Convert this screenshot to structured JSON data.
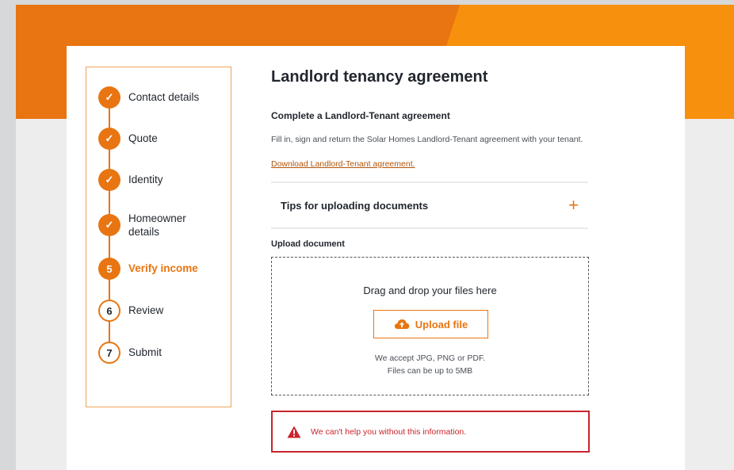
{
  "steps": [
    {
      "label": "Contact details",
      "state": "done",
      "marker": "✓"
    },
    {
      "label": "Quote",
      "state": "done",
      "marker": "✓"
    },
    {
      "label": "Identity",
      "state": "done",
      "marker": "✓"
    },
    {
      "label": "Homeowner details",
      "state": "done",
      "marker": "✓"
    },
    {
      "label": "Verify income",
      "state": "current",
      "marker": "5"
    },
    {
      "label": "Review",
      "state": "todo",
      "marker": "6"
    },
    {
      "label": "Submit",
      "state": "todo",
      "marker": "7"
    }
  ],
  "main": {
    "title": "Landlord tenancy agreement",
    "subtitle": "Complete a Landlord-Tenant agreement",
    "description": "Fill in, sign and return the Solar Homes Landlord-Tenant agreement with your tenant.",
    "download_link": "Download Landlord-Tenant agreement.",
    "tips_label": "Tips for uploading documents",
    "tips_icon": "+",
    "upload_label": "Upload document",
    "drop_text": "Drag and drop your files here",
    "upload_button": "Upload file",
    "accept_line1": "We accept JPG, PNG or PDF.",
    "accept_line2": "Files can be up to 5MB",
    "error_text": "We can't help you without this information."
  },
  "colors": {
    "accent": "#e87511",
    "accent_light": "#f7900c",
    "error": "#c8252c"
  },
  "icons": {
    "check": "check-icon",
    "plus": "plus-icon",
    "upload": "cloud-upload-icon",
    "warning": "warning-icon"
  }
}
